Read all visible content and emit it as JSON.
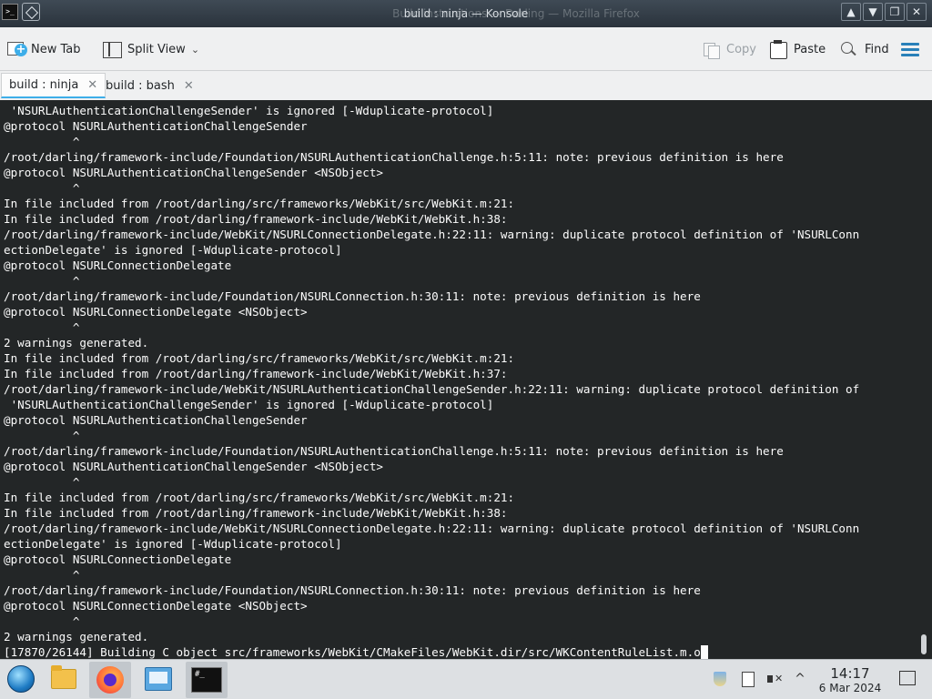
{
  "window": {
    "title": "build : ninja — Konsole",
    "ghost_title": "Build instructions — Darling — Mozilla Firefox",
    "app_icon_text": ">_",
    "buttons": {
      "keep_above": "▲",
      "minimize": "▼",
      "maximize": "❐",
      "close": "✕"
    }
  },
  "toolbar": {
    "new_tab": "New Tab",
    "split_view": "Split View",
    "copy": "Copy",
    "paste": "Paste",
    "find": "Find"
  },
  "tabs": [
    {
      "label": "build : ninja",
      "active": true,
      "close": "✕"
    },
    {
      "label": "build : bash",
      "active": false,
      "close": "✕"
    }
  ],
  "terminal": {
    "lines": [
      " 'NSURLAuthenticationChallengeSender' is ignored [-Wduplicate-protocol]",
      "@protocol NSURLAuthenticationChallengeSender",
      "          ^",
      "/root/darling/framework-include/Foundation/NSURLAuthenticationChallenge.h:5:11: note: previous definition is here",
      "@protocol NSURLAuthenticationChallengeSender <NSObject>",
      "          ^",
      "In file included from /root/darling/src/frameworks/WebKit/src/WebKit.m:21:",
      "In file included from /root/darling/framework-include/WebKit/WebKit.h:38:",
      "/root/darling/framework-include/WebKit/NSURLConnectionDelegate.h:22:11: warning: duplicate protocol definition of 'NSURLConn",
      "ectionDelegate' is ignored [-Wduplicate-protocol]",
      "@protocol NSURLConnectionDelegate",
      "          ^",
      "/root/darling/framework-include/Foundation/NSURLConnection.h:30:11: note: previous definition is here",
      "@protocol NSURLConnectionDelegate <NSObject>",
      "          ^",
      "2 warnings generated.",
      "In file included from /root/darling/src/frameworks/WebKit/src/WebKit.m:21:",
      "In file included from /root/darling/framework-include/WebKit/WebKit.h:37:",
      "/root/darling/framework-include/WebKit/NSURLAuthenticationChallengeSender.h:22:11: warning: duplicate protocol definition of",
      " 'NSURLAuthenticationChallengeSender' is ignored [-Wduplicate-protocol]",
      "@protocol NSURLAuthenticationChallengeSender",
      "          ^",
      "/root/darling/framework-include/Foundation/NSURLAuthenticationChallenge.h:5:11: note: previous definition is here",
      "@protocol NSURLAuthenticationChallengeSender <NSObject>",
      "          ^",
      "In file included from /root/darling/src/frameworks/WebKit/src/WebKit.m:21:",
      "In file included from /root/darling/framework-include/WebKit/WebKit.h:38:",
      "/root/darling/framework-include/WebKit/NSURLConnectionDelegate.h:22:11: warning: duplicate protocol definition of 'NSURLConn",
      "ectionDelegate' is ignored [-Wduplicate-protocol]",
      "@protocol NSURLConnectionDelegate",
      "          ^",
      "/root/darling/framework-include/Foundation/NSURLConnection.h:30:11: note: previous definition is here",
      "@protocol NSURLConnectionDelegate <NSObject>",
      "          ^",
      "2 warnings generated.",
      "[17870/26144] Building C object src/frameworks/WebKit/CMakeFiles/WebKit.dir/src/WKContentRuleList.m.o"
    ]
  },
  "taskbar": {
    "terminal_icon_text": "#_",
    "tray_up": "^",
    "time": "14:17",
    "date": "6 Mar 2024"
  }
}
